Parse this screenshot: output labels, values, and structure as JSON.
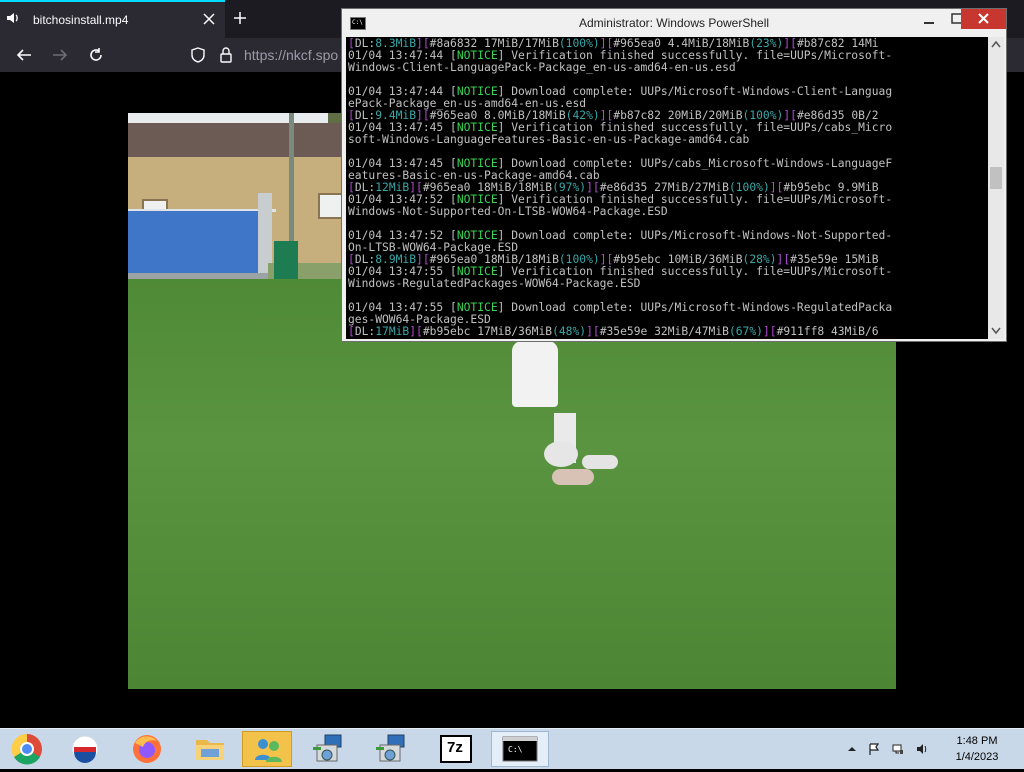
{
  "browser": {
    "tab_title": "bitchosinstall.mp4",
    "url": "https://nkcf.spo"
  },
  "powershell": {
    "title": "Administrator: Windows PowerShell",
    "lines": [
      [
        {
          "t": "[",
          "c": "purple"
        },
        {
          "t": "DL:",
          "c": "grey"
        },
        {
          "t": "8.3MiB",
          "c": "teal"
        },
        {
          "t": "][",
          "c": "purple"
        },
        {
          "t": "#8a6832 17MiB/17MiB",
          "c": "grey"
        },
        {
          "t": "(100%)",
          "c": "teal"
        },
        {
          "t": "][",
          "c": "purple"
        },
        {
          "t": "#965ea0 4.4MiB/18MiB",
          "c": "grey"
        },
        {
          "t": "(23%)",
          "c": "teal"
        },
        {
          "t": "][",
          "c": "purple"
        },
        {
          "t": "#b87c82 14Mi",
          "c": "grey"
        }
      ],
      [
        {
          "t": "01/04 13:47:44 [",
          "c": "grey"
        },
        {
          "t": "NOTICE",
          "c": "green"
        },
        {
          "t": "] Verification finished successfully. file=UUPs/Microsoft-",
          "c": "grey"
        }
      ],
      [
        {
          "t": "Windows-Client-LanguagePack-Package_en-us-amd64-en-us.esd",
          "c": "grey"
        }
      ],
      [],
      [
        {
          "t": "01/04 13:47:44 [",
          "c": "grey"
        },
        {
          "t": "NOTICE",
          "c": "green"
        },
        {
          "t": "] Download complete: UUPs/Microsoft-Windows-Client-Languag",
          "c": "grey"
        }
      ],
      [
        {
          "t": "ePack-Package_en-us-amd64-en-us.esd",
          "c": "grey"
        }
      ],
      [
        {
          "t": "[",
          "c": "purple"
        },
        {
          "t": "DL:",
          "c": "grey"
        },
        {
          "t": "9.4MiB",
          "c": "teal"
        },
        {
          "t": "][",
          "c": "purple"
        },
        {
          "t": "#965ea0 8.0MiB/18MiB",
          "c": "grey"
        },
        {
          "t": "(42%)",
          "c": "teal"
        },
        {
          "t": "][",
          "c": "purple"
        },
        {
          "t": "#b87c82 20MiB/20MiB",
          "c": "grey"
        },
        {
          "t": "(100%)",
          "c": "teal"
        },
        {
          "t": "][",
          "c": "purple"
        },
        {
          "t": "#e86d35 0B/2",
          "c": "grey"
        }
      ],
      [
        {
          "t": "01/04 13:47:45 [",
          "c": "grey"
        },
        {
          "t": "NOTICE",
          "c": "green"
        },
        {
          "t": "] Verification finished successfully. file=UUPs/cabs_Micro",
          "c": "grey"
        }
      ],
      [
        {
          "t": "soft-Windows-LanguageFeatures-Basic-en-us-Package-amd64.cab",
          "c": "grey"
        }
      ],
      [],
      [
        {
          "t": "01/04 13:47:45 [",
          "c": "grey"
        },
        {
          "t": "NOTICE",
          "c": "green"
        },
        {
          "t": "] Download complete: UUPs/cabs_Microsoft-Windows-LanguageF",
          "c": "grey"
        }
      ],
      [
        {
          "t": "eatures-Basic-en-us-Package-amd64.cab",
          "c": "grey"
        }
      ],
      [
        {
          "t": "[",
          "c": "purple"
        },
        {
          "t": "DL:",
          "c": "grey"
        },
        {
          "t": "12MiB",
          "c": "teal"
        },
        {
          "t": "][",
          "c": "purple"
        },
        {
          "t": "#965ea0 18MiB/18MiB",
          "c": "grey"
        },
        {
          "t": "(97%)",
          "c": "teal"
        },
        {
          "t": "][",
          "c": "purple"
        },
        {
          "t": "#e86d35 27MiB/27MiB",
          "c": "grey"
        },
        {
          "t": "(100%)",
          "c": "teal"
        },
        {
          "t": "][",
          "c": "purple"
        },
        {
          "t": "#b95ebc 9.9MiB",
          "c": "grey"
        }
      ],
      [
        {
          "t": "01/04 13:47:52 [",
          "c": "grey"
        },
        {
          "t": "NOTICE",
          "c": "green"
        },
        {
          "t": "] Verification finished successfully. file=UUPs/Microsoft-",
          "c": "grey"
        }
      ],
      [
        {
          "t": "Windows-Not-Supported-On-LTSB-WOW64-Package.ESD",
          "c": "grey"
        }
      ],
      [],
      [
        {
          "t": "01/04 13:47:52 [",
          "c": "grey"
        },
        {
          "t": "NOTICE",
          "c": "green"
        },
        {
          "t": "] Download complete: UUPs/Microsoft-Windows-Not-Supported-",
          "c": "grey"
        }
      ],
      [
        {
          "t": "On-LTSB-WOW64-Package.ESD",
          "c": "grey"
        }
      ],
      [
        {
          "t": "[",
          "c": "purple"
        },
        {
          "t": "DL:",
          "c": "grey"
        },
        {
          "t": "8.9MiB",
          "c": "teal"
        },
        {
          "t": "][",
          "c": "purple"
        },
        {
          "t": "#965ea0 18MiB/18MiB",
          "c": "grey"
        },
        {
          "t": "(100%)",
          "c": "teal"
        },
        {
          "t": "][",
          "c": "purple"
        },
        {
          "t": "#b95ebc 10MiB/36MiB",
          "c": "grey"
        },
        {
          "t": "(28%)",
          "c": "teal"
        },
        {
          "t": "][",
          "c": "purple"
        },
        {
          "t": "#35e59e 15MiB",
          "c": "grey"
        }
      ],
      [
        {
          "t": "01/04 13:47:55 [",
          "c": "grey"
        },
        {
          "t": "NOTICE",
          "c": "green"
        },
        {
          "t": "] Verification finished successfully. file=UUPs/Microsoft-",
          "c": "grey"
        }
      ],
      [
        {
          "t": "Windows-RegulatedPackages-WOW64-Package.ESD",
          "c": "grey"
        }
      ],
      [],
      [
        {
          "t": "01/04 13:47:55 [",
          "c": "grey"
        },
        {
          "t": "NOTICE",
          "c": "green"
        },
        {
          "t": "] Download complete: UUPs/Microsoft-Windows-RegulatedPacka",
          "c": "grey"
        }
      ],
      [
        {
          "t": "ges-WOW64-Package.ESD",
          "c": "grey"
        }
      ],
      [
        {
          "t": "[",
          "c": "purple"
        },
        {
          "t": "DL:",
          "c": "grey"
        },
        {
          "t": "17MiB",
          "c": "teal"
        },
        {
          "t": "][",
          "c": "purple"
        },
        {
          "t": "#b95ebc 17MiB/36MiB",
          "c": "grey"
        },
        {
          "t": "(48%)",
          "c": "teal"
        },
        {
          "t": "][",
          "c": "purple"
        },
        {
          "t": "#35e59e 32MiB/47MiB",
          "c": "grey"
        },
        {
          "t": "(67%)",
          "c": "teal"
        },
        {
          "t": "][",
          "c": "purple"
        },
        {
          "t": "#911ff8 43MiB/6",
          "c": "grey"
        }
      ]
    ]
  },
  "taskbar": {
    "apps": [
      {
        "name": "chrome-icon",
        "active": false
      },
      {
        "name": "opera-icon",
        "active": false
      },
      {
        "name": "firefox-icon",
        "active": false
      },
      {
        "name": "file-explorer-icon",
        "active": false
      },
      {
        "name": "users-icon",
        "active": false
      },
      {
        "name": "network-installer-icon",
        "active": false
      },
      {
        "name": "network-installer-2-icon",
        "active": false
      },
      {
        "name": "7zip-icon",
        "active": false
      },
      {
        "name": "powershell-icon",
        "active": true
      }
    ],
    "seven_zip_label": "7z",
    "ps_label": "C:\\",
    "time": "1:48 PM",
    "date": "1/4/2023"
  },
  "colors": {
    "notice": "#39d353",
    "bracket": "#b04bd6",
    "percent": "#3aa7a7",
    "browser_accent": "#00ddff",
    "close_red": "#c7372f"
  }
}
